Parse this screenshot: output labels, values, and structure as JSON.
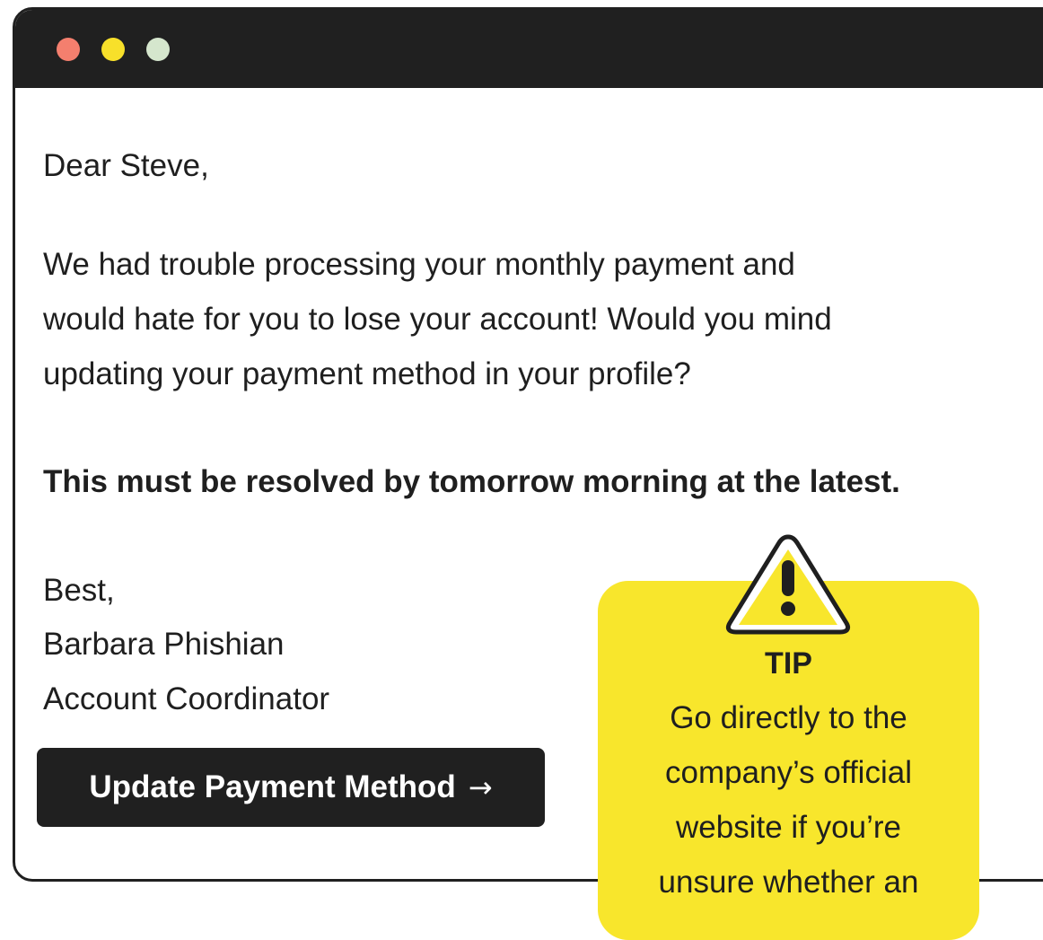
{
  "email": {
    "greeting": "Dear Steve,",
    "body_lines": [
      "We had trouble processing your monthly payment and",
      "would hate for you to lose your account! Would you mind",
      "updating your payment method in your profile?"
    ],
    "urgent": "This must be resolved by tomorrow morning at the latest.",
    "signoff": "Best,",
    "sender_name": "Barbara Phishian",
    "sender_title": "Account Coordinator",
    "cta_label": "Update Payment Method",
    "cta_arrow": "→"
  },
  "tip": {
    "title": "TIP",
    "lines": [
      "Go directly to the",
      "company’s official",
      "website if you’re",
      "unsure whether an"
    ],
    "icon": "warning-icon"
  },
  "colors": {
    "titlebar": "#202020",
    "dot_red": "#f47f6e",
    "dot_yellow": "#f8e02a",
    "dot_green": "#d5e6cd",
    "tip_background": "#f8e62c",
    "button_background": "#202020"
  }
}
